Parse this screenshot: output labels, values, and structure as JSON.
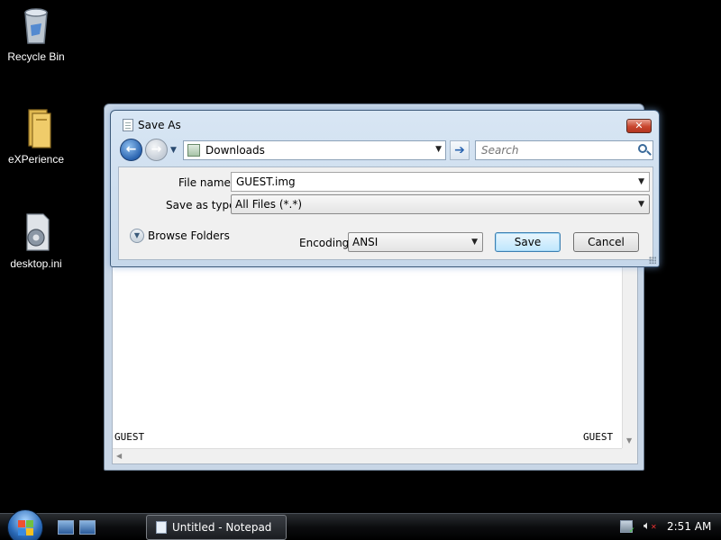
{
  "desktop": {
    "icons": [
      {
        "label": "Recycle Bin"
      },
      {
        "label": "eXPerience"
      },
      {
        "label": "desktop.ini"
      }
    ]
  },
  "notepad": {
    "text_left": "GUEST",
    "text_right": "GUEST"
  },
  "dialog": {
    "title": "Save As",
    "close_label": "✕",
    "address": "Downloads",
    "search_placeholder": "Search",
    "file_name_label": "File name:",
    "file_name_value": "GUEST.img",
    "save_type_label": "Save as type:",
    "save_type_value": "All Files  (*.*)",
    "browse_label": "Browse Folders",
    "encoding_label": "Encoding:",
    "encoding_value": "ANSI",
    "save_label": "Save",
    "cancel_label": "Cancel"
  },
  "taskbar": {
    "task_label": "Untitled - Notepad",
    "clock": "2:51 AM"
  },
  "icons": [
    "recycle-bin-icon",
    "folder-icon",
    "settings-file-icon",
    "notepad-icon",
    "back-arrow-icon",
    "forward-arrow-icon",
    "search-icon",
    "windows-logo-icon",
    "network-icon",
    "volume-muted-icon"
  ]
}
